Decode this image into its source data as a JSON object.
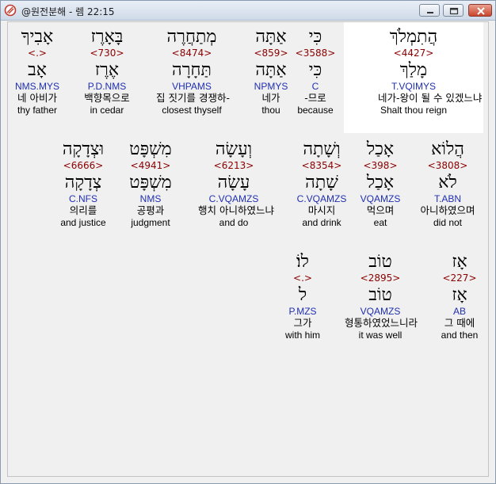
{
  "window": {
    "title": "@원전분해 - 렘 22:15",
    "controls": [
      "minimize",
      "maximize",
      "close"
    ]
  },
  "rows": [
    {
      "words": [
        {
          "hebrew": "אָבִיךָ",
          "strong": "<.>",
          "lemma": "אָב",
          "morph": "NMS.MYS",
          "korean": "네 아비가",
          "english": "thy father"
        },
        {
          "hebrew": "בָּאָרֶז",
          "strong": "<730>",
          "lemma": "אֶרֶז",
          "morph": "P.D.NMS",
          "korean": "백향목으로",
          "english": "in cedar"
        },
        {
          "hebrew": "מְתַחֲרֶה",
          "strong": "<8474>",
          "lemma": "תַּחָרָה",
          "morph": "VHPAMS",
          "korean": "집 짓기를 경쟁하-",
          "english": "closest thyself"
        },
        {
          "hebrew": "אַתָּה",
          "strong": "<859>",
          "lemma": "אַתָּה",
          "morph": "NPMYS",
          "korean": "네가",
          "english": "thou"
        },
        {
          "hebrew": "כִּי",
          "strong": "<3588>",
          "lemma": "כִּי",
          "morph": "C",
          "korean": "-므로",
          "english": "because"
        },
        {
          "hebrew": "הֲתִמְלֹךְ",
          "strong": "<4427>",
          "lemma": "מָלַךְ",
          "morph": "T.VQIMYS",
          "korean": "네가-왕이 될 수 있겠느냐",
          "english": "Shalt thou reign"
        }
      ]
    },
    {
      "words": [
        {
          "hebrew": "וּצְדָקָה",
          "strong": "<6666>",
          "lemma": "צְדָקָה",
          "morph": "C.NFS",
          "korean": "의리를",
          "english": "and justice"
        },
        {
          "hebrew": "מִשְׁפָּט",
          "strong": "<4941>",
          "lemma": "מִשְׁפָּט",
          "morph": "NMS",
          "korean": "공평과",
          "english": "judgment"
        },
        {
          "hebrew": "וְעָשָׂה",
          "strong": "<6213>",
          "lemma": "עָשָׂה",
          "morph": "C.VQAMZS",
          "korean": "행치 아니하였느냐",
          "english": "and do"
        },
        {
          "hebrew": "וְשָׁתָה",
          "strong": "<8354>",
          "lemma": "שָׁתָה",
          "morph": "C.VQAMZS",
          "korean": "마시지",
          "english": "and drink"
        },
        {
          "hebrew": "אָכַל",
          "strong": "<398>",
          "lemma": "אָכַל",
          "morph": "VQAMZS",
          "korean": "먹으며",
          "english": "eat"
        },
        {
          "hebrew": "הֲלוֹא",
          "strong": "<3808>",
          "lemma": "לֹא",
          "morph": "T.ABN",
          "korean": "아니하였으며",
          "english": "did not"
        }
      ]
    },
    {
      "words": [
        {
          "hebrew": "לוֹ׃",
          "strong": "<.>",
          "lemma": "ל",
          "morph": "P.MZS",
          "korean": "그가",
          "english": "with him"
        },
        {
          "hebrew": "טוֹב",
          "strong": "<2895>",
          "lemma": "טוֹב",
          "morph": "VQAMZS",
          "korean": "형통하였었느니라",
          "english": "it was well"
        },
        {
          "hebrew": "אָז",
          "strong": "<227>",
          "lemma": "אָז",
          "morph": "AB",
          "korean": "그 때에",
          "english": "and then"
        }
      ]
    }
  ]
}
